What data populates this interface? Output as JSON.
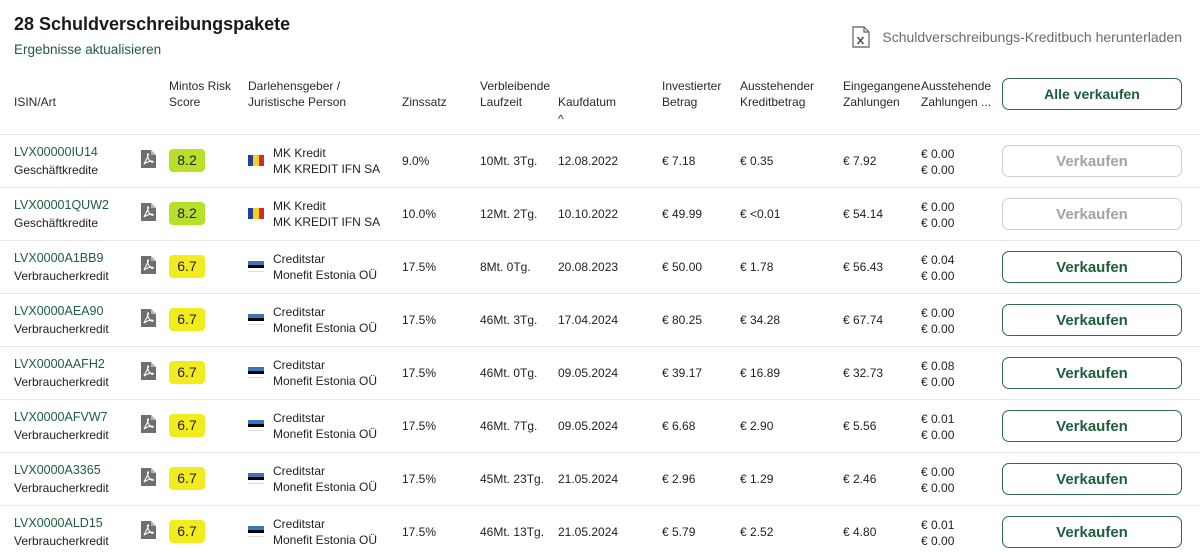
{
  "header": {
    "title": "28 Schuldverschreibungspakete",
    "refresh_link": "Ergebnisse aktualisieren",
    "download_label": "Schuldverschreibungs-Kreditbuch herunterladen",
    "download_icon": "excel-file-icon"
  },
  "columns": {
    "isin": "ISIN/Art",
    "risk1": "Mintos Risk",
    "risk2": "Score",
    "lender1": "Darlehensgeber /",
    "lender2": "Juristische Person",
    "rate": "Zinssatz",
    "term1": "Verbleibende",
    "term2": "Laufzeit",
    "date": "Kaufdatum",
    "sort_indicator": "^",
    "invested1": "Investierter",
    "invested2": "Betrag",
    "outstanding1": "Ausstehender",
    "outstanding2": "Kreditbetrag",
    "received1": "Eingegangene",
    "received2": "Zahlungen",
    "due1": "Ausstehende",
    "due2": "Zahlungen ..."
  },
  "sell_all_label": "Alle verkaufen",
  "colors": {
    "accent": "#1c5f3a",
    "score_green": "#b8e02a",
    "score_yellow": "#f2ec1e"
  },
  "rows": [
    {
      "isin": "LVX00000IU14",
      "type": "Geschäftkredite",
      "score": "8.2",
      "score_color": "#b8e02a",
      "country": "romania",
      "lender": "MK Kredit",
      "entity": "MK KREDIT IFN SA",
      "rate": "9.0%",
      "term": "10Mt. 3Tg.",
      "date": "12.08.2022",
      "invested": "€ 7.18",
      "outstanding": "€ 0.35",
      "received": "€ 7.92",
      "due_a": "€ 0.00",
      "due_b": "€ 0.00",
      "sell": "Verkaufen",
      "sell_enabled": false
    },
    {
      "isin": "LVX00001QUW2",
      "type": "Geschäftkredite",
      "score": "8.2",
      "score_color": "#b8e02a",
      "country": "romania",
      "lender": "MK Kredit",
      "entity": "MK KREDIT IFN SA",
      "rate": "10.0%",
      "term": "12Mt. 2Tg.",
      "date": "10.10.2022",
      "invested": "€ 49.99",
      "outstanding": "€ <0.01",
      "received": "€ 54.14",
      "due_a": "€ 0.00",
      "due_b": "€ 0.00",
      "sell": "Verkaufen",
      "sell_enabled": false
    },
    {
      "isin": "LVX0000A1BB9",
      "type": "Verbraucherkredit",
      "score": "6.7",
      "score_color": "#f2ec1e",
      "country": "estonia",
      "lender": "Creditstar",
      "entity": "Monefit Estonia OÜ",
      "rate": "17.5%",
      "term": "8Mt. 0Tg.",
      "date": "20.08.2023",
      "invested": "€ 50.00",
      "outstanding": "€ 1.78",
      "received": "€ 56.43",
      "due_a": "€ 0.04",
      "due_b": "€ 0.00",
      "sell": "Verkaufen",
      "sell_enabled": true
    },
    {
      "isin": "LVX0000AEA90",
      "type": "Verbraucherkredit",
      "score": "6.7",
      "score_color": "#f2ec1e",
      "country": "estonia",
      "lender": "Creditstar",
      "entity": "Monefit Estonia OÜ",
      "rate": "17.5%",
      "term": "46Mt. 3Tg.",
      "date": "17.04.2024",
      "invested": "€ 80.25",
      "outstanding": "€ 34.28",
      "received": "€ 67.74",
      "due_a": "€ 0.00",
      "due_b": "€ 0.00",
      "sell": "Verkaufen",
      "sell_enabled": true
    },
    {
      "isin": "LVX0000AAFH2",
      "type": "Verbraucherkredit",
      "score": "6.7",
      "score_color": "#f2ec1e",
      "country": "estonia",
      "lender": "Creditstar",
      "entity": "Monefit Estonia OÜ",
      "rate": "17.5%",
      "term": "46Mt. 0Tg.",
      "date": "09.05.2024",
      "invested": "€ 39.17",
      "outstanding": "€ 16.89",
      "received": "€ 32.73",
      "due_a": "€ 0.08",
      "due_b": "€ 0.00",
      "sell": "Verkaufen",
      "sell_enabled": true
    },
    {
      "isin": "LVX0000AFVW7",
      "type": "Verbraucherkredit",
      "score": "6.7",
      "score_color": "#f2ec1e",
      "country": "estonia",
      "lender": "Creditstar",
      "entity": "Monefit Estonia OÜ",
      "rate": "17.5%",
      "term": "46Mt. 7Tg.",
      "date": "09.05.2024",
      "invested": "€ 6.68",
      "outstanding": "€ 2.90",
      "received": "€ 5.56",
      "due_a": "€ 0.01",
      "due_b": "€ 0.00",
      "sell": "Verkaufen",
      "sell_enabled": true
    },
    {
      "isin": "LVX0000A3365",
      "type": "Verbraucherkredit",
      "score": "6.7",
      "score_color": "#f2ec1e",
      "country": "estonia",
      "lender": "Creditstar",
      "entity": "Monefit Estonia OÜ",
      "rate": "17.5%",
      "term": "45Mt. 23Tg.",
      "date": "21.05.2024",
      "invested": "€ 2.96",
      "outstanding": "€ 1.29",
      "received": "€ 2.46",
      "due_a": "€ 0.00",
      "due_b": "€ 0.00",
      "sell": "Verkaufen",
      "sell_enabled": true
    },
    {
      "isin": "LVX0000ALD15",
      "type": "Verbraucherkredit",
      "score": "6.7",
      "score_color": "#f2ec1e",
      "country": "estonia",
      "lender": "Creditstar",
      "entity": "Monefit Estonia OÜ",
      "rate": "17.5%",
      "term": "46Mt. 13Tg.",
      "date": "21.05.2024",
      "invested": "€ 5.79",
      "outstanding": "€ 2.52",
      "received": "€ 4.80",
      "due_a": "€ 0.01",
      "due_b": "€ 0.00",
      "sell": "Verkaufen",
      "sell_enabled": true
    }
  ]
}
